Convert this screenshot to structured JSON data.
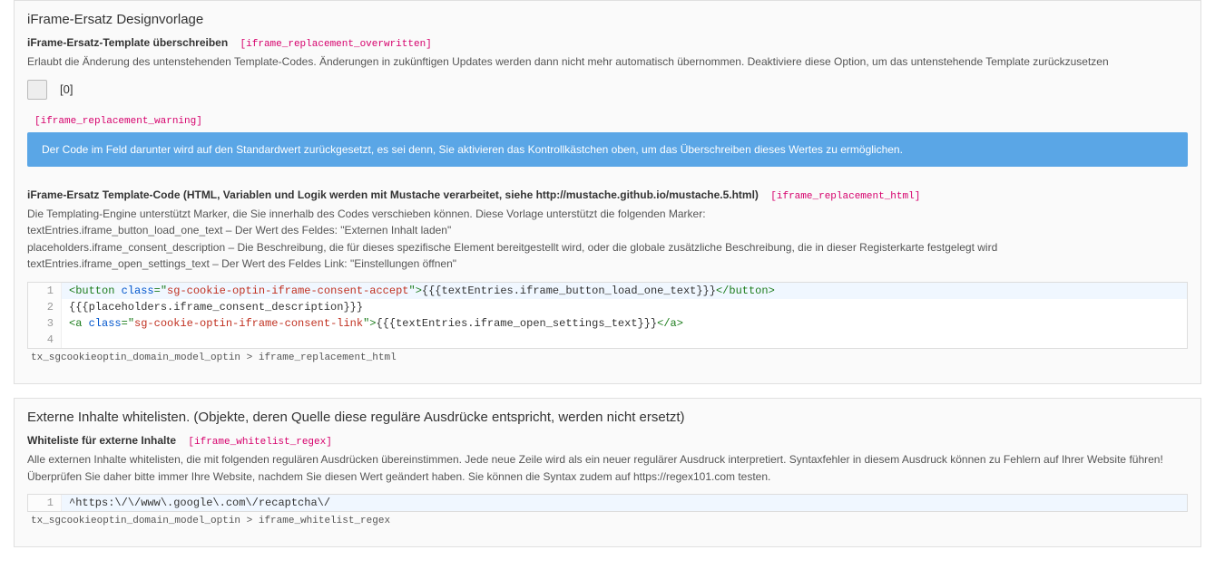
{
  "section1": {
    "title": "iFrame-Ersatz Designvorlage",
    "field_overwrite": {
      "label": "iFrame-Ersatz-Template überschreiben",
      "key": "[iframe_replacement_overwritten]",
      "help": "Erlaubt die Änderung des untenstehenden Template-Codes. Änderungen in zukünftigen Updates werden dann nicht mehr automatisch übernommen. Deaktiviere diese Option, um das untenstehende Template zurückzusetzen",
      "checkbox_value": "[0]"
    },
    "warning": {
      "key": "[iframe_replacement_warning]",
      "text": "Der Code im Feld darunter wird auf den Standardwert zurückgesetzt, es sei denn, Sie aktivieren das Kontrollkästchen oben, um das Überschreiben dieses Wertes zu ermöglichen."
    },
    "field_html": {
      "label": "iFrame-Ersatz Template-Code (HTML, Variablen und Logik werden mit Mustache verarbeitet, siehe http://mustache.github.io/mustache.5.html)",
      "key": "[iframe_replacement_html]",
      "help_line1": "Die Templating-Engine unterstützt Marker, die Sie innerhalb des Codes verschieben können. Diese Vorlage unterstützt die folgenden Marker:",
      "help_line2": "textEntries.iframe_button_load_one_text – Der Wert des Feldes: \"Externen Inhalt laden\"",
      "help_line3": "placeholders.iframe_consent_description – Die Beschreibung, die für dieses spezifische Element bereitgestellt wird, oder die globale zusätzliche Beschreibung, die in dieser Registerkarte festgelegt wird",
      "help_line4": "textEntries.iframe_open_settings_text – Der Wert des Feldes Link: \"Einstellungen öffnen\"",
      "code_lines": {
        "l1_open_tag": "<button",
        "l1_attr": " class",
        "l1_eq_open": "=\"",
        "l1_str": "sg-cookie-optin-iframe-consent-accept",
        "l1_close_q": "\">",
        "l1_tmpl": "{{{textEntries.iframe_button_load_one_text}}}",
        "l1_close_tag": "</button>",
        "l2": "{{{placeholders.iframe_consent_description}}}",
        "l3_open_tag": "<a",
        "l3_attr": " class",
        "l3_eq_open": "=\"",
        "l3_str": "sg-cookie-optin-iframe-consent-link",
        "l3_close_q": "\">",
        "l3_tmpl": "{{{textEntries.iframe_open_settings_text}}}",
        "l3_close_tag": "</a>"
      },
      "breadcrumb": "tx_sgcookieoptin_domain_model_optin > iframe_replacement_html"
    }
  },
  "section2": {
    "title": "Externe Inhalte whitelisten. (Objekte, deren Quelle diese reguläre Ausdrücke entspricht, werden nicht ersetzt)",
    "field_regex": {
      "label": "Whiteliste für externe Inhalte",
      "key": "[iframe_whitelist_regex]",
      "help": "Alle externen Inhalte whitelisten, die mit folgenden regulären Ausdrücken übereinstimmen. Jede neue Zeile wird als ein neuer regulärer Ausdruck interpretiert. Syntaxfehler in diesem Ausdruck können zu Fehlern auf Ihrer Website führen! Überprüfen Sie daher bitte immer Ihre Website, nachdem Sie diesen Wert geändert haben. Sie können die Syntax zudem auf https://regex101.com testen.",
      "code_line1": "^https:\\/\\/www\\.google\\.com\\/recaptcha\\/",
      "breadcrumb": "tx_sgcookieoptin_domain_model_optin > iframe_whitelist_regex"
    }
  },
  "line_numbers": {
    "n1": "1",
    "n2": "2",
    "n3": "3",
    "n4": "4"
  }
}
